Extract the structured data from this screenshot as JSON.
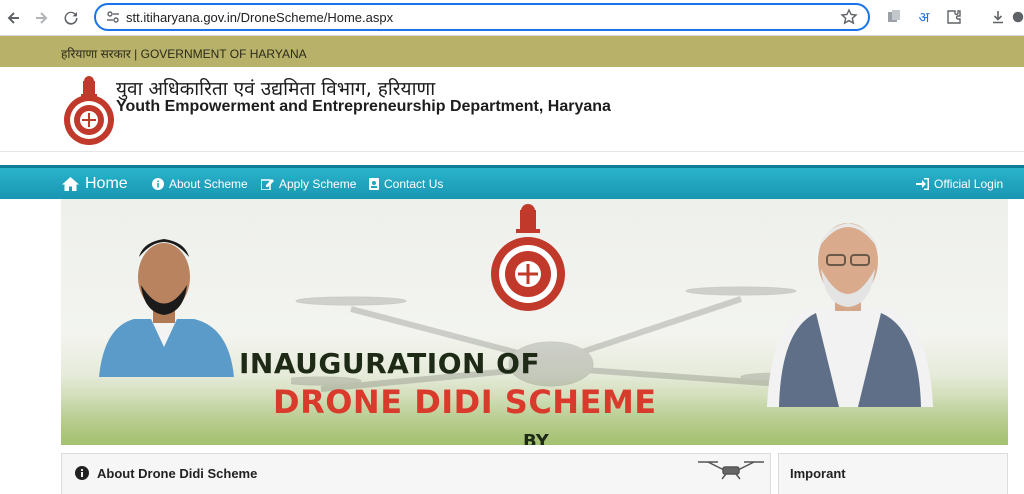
{
  "browser": {
    "url": "stt.itiharyana.gov.in/DroneScheme/Home.aspx",
    "translate_label": "अ"
  },
  "gov_strip": {
    "text": "हरियाणा सरकार  |  GOVERNMENT OF HARYANA"
  },
  "header": {
    "title_hindi": "युवा अधिकारिता एवं उद्यमिता विभाग, हरियाणा",
    "title_english": "Youth Empowerment and Entrepreneurship Department, Haryana"
  },
  "nav": {
    "home": "Home",
    "about": "About Scheme",
    "apply": "Apply Scheme",
    "contact": "Contact Us",
    "login": "Official Login"
  },
  "banner": {
    "line1": "INAUGURATION OF",
    "line2": "DRONE DIDI SCHEME",
    "line3": "BY"
  },
  "panels": {
    "about_title": "About Drone Didi Scheme",
    "important_title": "Imporant"
  },
  "colors": {
    "nav_bar": "#1fa6c0",
    "gov_strip": "#b8b16a",
    "banner_red": "#d93a2b",
    "omnibox_focus": "#1a73e8"
  }
}
